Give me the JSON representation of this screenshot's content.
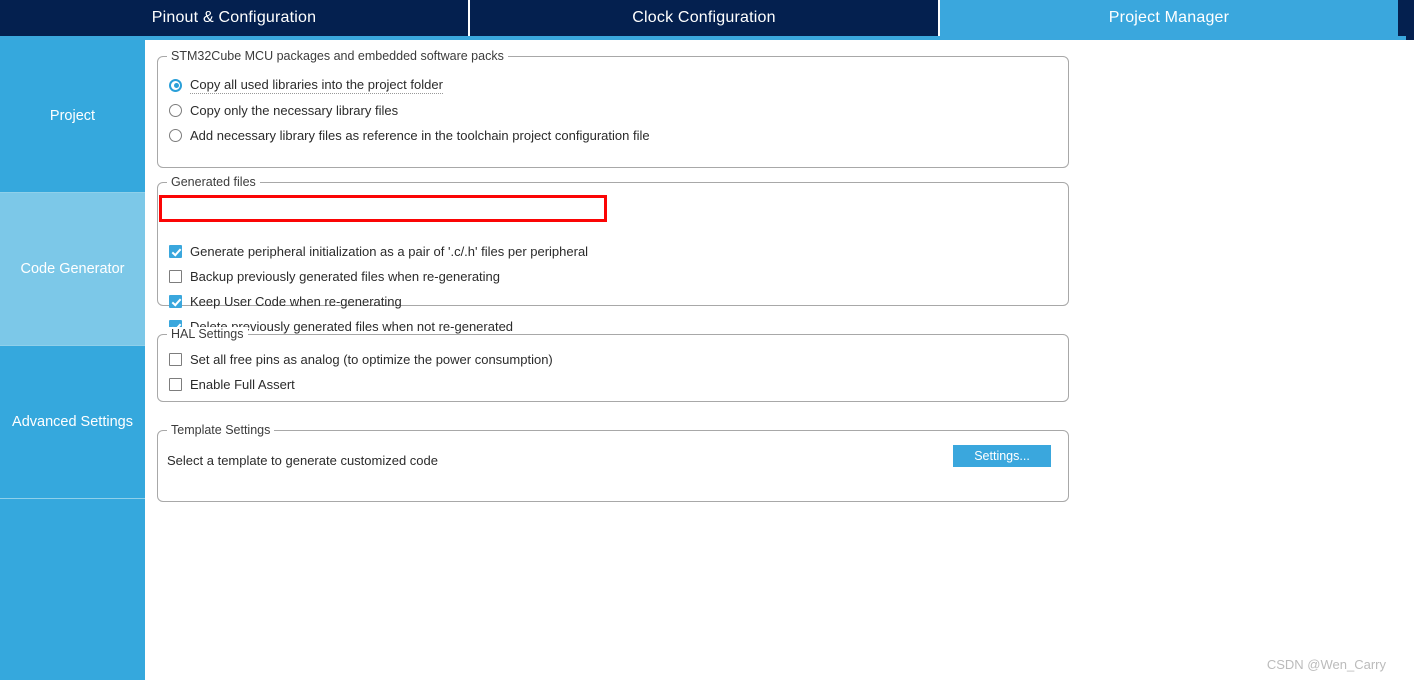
{
  "tabs": [
    {
      "label": "Pinout & Configuration",
      "active": false
    },
    {
      "label": "Clock Configuration",
      "active": false
    },
    {
      "label": "Project Manager",
      "active": true
    }
  ],
  "sidebar": {
    "items": [
      {
        "label": "Project",
        "selected": false
      },
      {
        "label": "Code Generator",
        "selected": true
      },
      {
        "label": "Advanced Settings",
        "selected": false
      },
      {
        "label": "",
        "selected": false
      }
    ]
  },
  "groups": {
    "packages": {
      "title": "STM32Cube MCU packages and embedded software packs",
      "options": [
        {
          "label": "Copy all used libraries into the project folder",
          "checked": true,
          "focused": true
        },
        {
          "label": "Copy only the necessary library files",
          "checked": false,
          "focused": false
        },
        {
          "label": "Add necessary library files as reference in the toolchain project configuration file",
          "checked": false,
          "focused": false
        }
      ]
    },
    "generated": {
      "title": "Generated files",
      "options": [
        {
          "label": "Generate peripheral initialization as a pair of '.c/.h' files per peripheral",
          "checked": true,
          "highlighted": true
        },
        {
          "label": "Backup previously generated files when re-generating",
          "checked": false,
          "highlighted": false
        },
        {
          "label": "Keep User Code when re-generating",
          "checked": true,
          "highlighted": false
        },
        {
          "label": "Delete previously generated files when not re-generated",
          "checked": true,
          "highlighted": false
        }
      ]
    },
    "hal": {
      "title": "HAL Settings",
      "options": [
        {
          "label": "Set all free pins as analog (to optimize the power consumption)",
          "checked": false
        },
        {
          "label": "Enable Full Assert",
          "checked": false
        }
      ]
    },
    "template": {
      "title": "Template Settings",
      "description": "Select a template to generate customized code",
      "settings_button": "Settings..."
    }
  },
  "annotation": {
    "color": "#fb0505"
  },
  "watermark": "CSDN @Wen_Carry",
  "colors": {
    "tab_inactive_bg": "#04204f",
    "tab_active_bg": "#3aa7dd",
    "sidebar_bg": "#35a8dd",
    "sidebar_selected_bg": "#7cc8e8",
    "accent": "#3aa7dd"
  }
}
